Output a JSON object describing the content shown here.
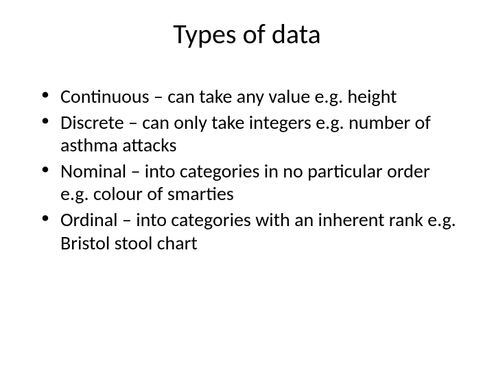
{
  "slide": {
    "title": "Types of data",
    "bullets": [
      "Continuous – can take any value e.g. height",
      "Discrete – can only take integers e.g. number of asthma attacks",
      "Nominal – into categories in no particular order e.g. colour of smarties",
      "Ordinal – into categories with an inherent rank e.g. Bristol stool chart"
    ]
  }
}
